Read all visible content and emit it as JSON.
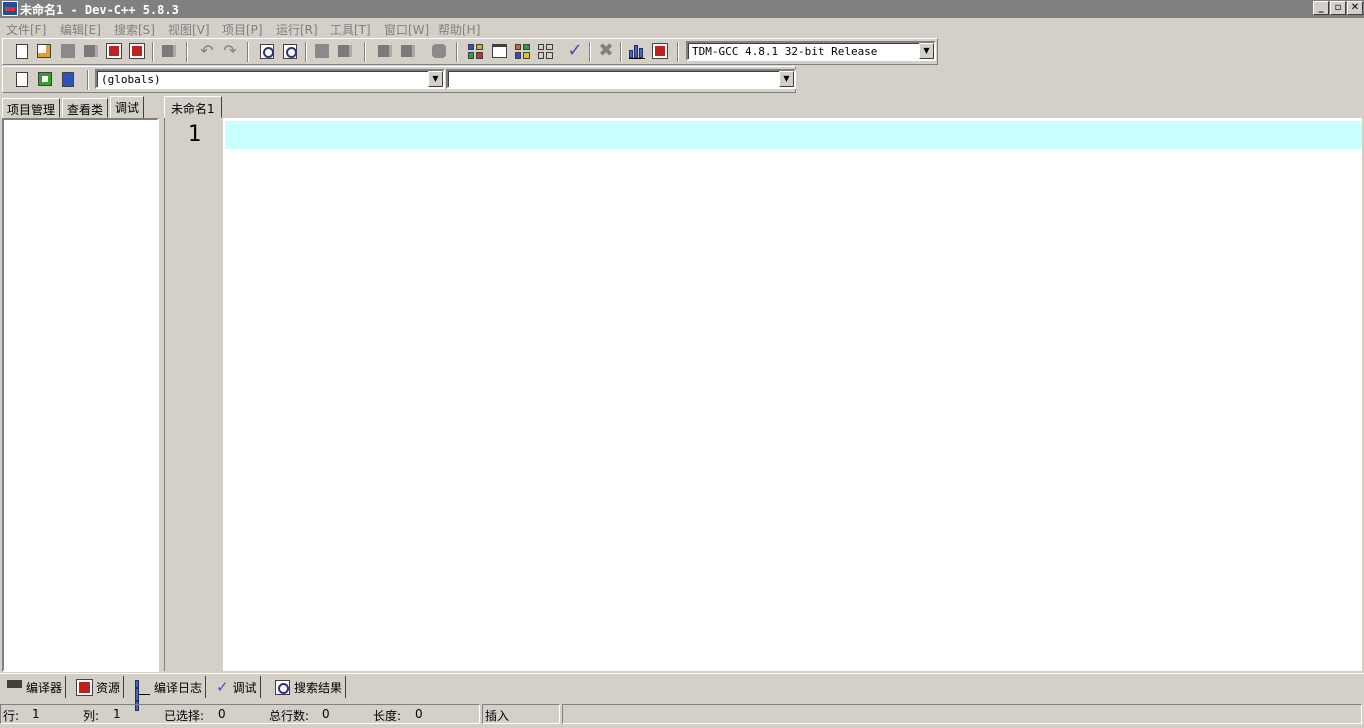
{
  "window": {
    "title": "未命名1 - Dev-C++ 5.8.3",
    "minimize": "_",
    "restore": "▫",
    "close": "✕"
  },
  "menu": [
    "文件[F]",
    "编辑[E]",
    "搜索[S]",
    "视图[V]",
    "项目[P]",
    "运行[R]",
    "工具[T]",
    "窗口[W]",
    "帮助[H]"
  ],
  "toolbar": {
    "compiler_select": "TDM-GCC 4.8.1 32-bit Release",
    "class_select": "(globals)",
    "member_select": ""
  },
  "left_tabs": [
    "项目管理",
    "查看类",
    "调试"
  ],
  "left_active_tab": "调试",
  "editor": {
    "tab": "未命名1",
    "line_numbers": [
      "1"
    ]
  },
  "bottom_tabs": [
    "编译器",
    "资源",
    "编译日志",
    "调试",
    "搜索结果"
  ],
  "status": {
    "row_label": "行:",
    "row": "1",
    "col_label": "列:",
    "col": "1",
    "selected_label": "已选择:",
    "selected": "0",
    "total_label": "总行数:",
    "total": "0",
    "length_label": "长度:",
    "length": "0",
    "mode": "插入"
  },
  "colors": {
    "current_line": "#caffff",
    "title_bar": "#808080",
    "chrome": "#d4d0c8"
  }
}
